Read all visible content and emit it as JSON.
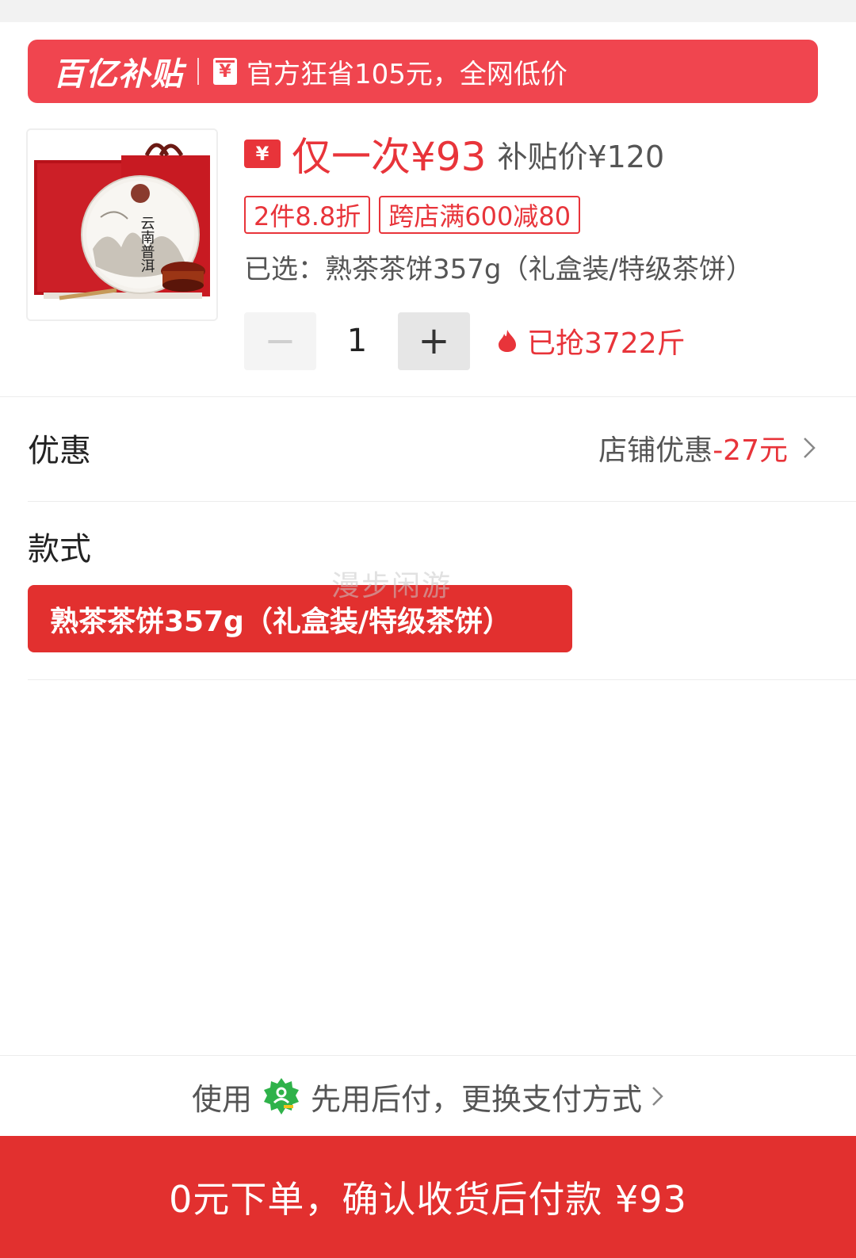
{
  "banner": {
    "logo_text": "百亿补贴",
    "coupon_icon_glyph": "¥",
    "text": "官方狂省105元，全网低价"
  },
  "product": {
    "image": "tea-gift-box",
    "price_icon_glyph": "¥",
    "once_price": "仅一次¥93",
    "subsidy_price": "补贴价¥120",
    "tags": [
      "2件8.8折",
      "跨店满600减80"
    ],
    "selected": "已选：熟茶茶饼357g（礼盒装/特级茶饼）",
    "image_text": "云南普洱"
  },
  "stepper": {
    "minus": "−",
    "quantity": "1",
    "plus": "+",
    "sold": "已抢3722斤"
  },
  "discount": {
    "label": "优惠",
    "store_prefix": "店铺优惠",
    "amount": "-27元"
  },
  "style": {
    "label": "款式",
    "option": "熟茶茶饼357g（礼盒装/特级茶饼）"
  },
  "watermark": "漫步闲游",
  "payment": {
    "prefix": "使用",
    "method": "先用后付，更换支付方式"
  },
  "order_button": "0元下单，确认收货后付款 ¥93",
  "colors": {
    "banner": "#f0454f",
    "accent": "#e8343a",
    "button": "#e2302f",
    "badge_green": "#2fb24a"
  }
}
